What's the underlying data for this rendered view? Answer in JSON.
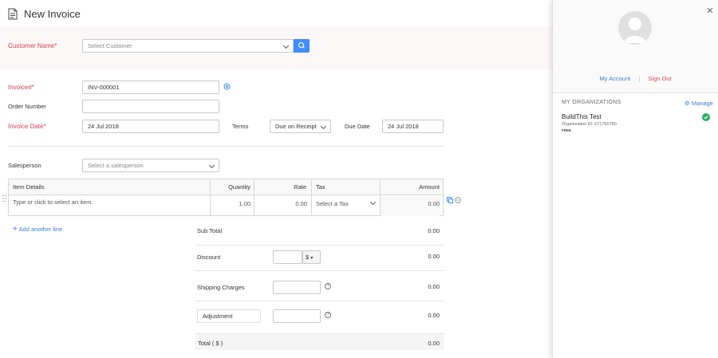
{
  "header": {
    "title": "New Invoice",
    "icon": "document-icon"
  },
  "customer": {
    "label": "Customer Name*",
    "placeholder": "Select Customer"
  },
  "invoice_number": {
    "label": "Invoice#*",
    "value": "INV-000001"
  },
  "order_number": {
    "label": "Order Number",
    "value": ""
  },
  "invoice_date": {
    "label": "Invoice Date*",
    "value": "24 Jul 2018"
  },
  "terms": {
    "label": "Terms",
    "value": "Due on Receipt"
  },
  "due_date": {
    "label": "Due Date",
    "value": "24 Jul 2018"
  },
  "salesperson": {
    "label": "Salesperson",
    "placeholder": "Select a salesperson"
  },
  "items_table": {
    "headers": {
      "item": "Item Details",
      "quantity": "Quantity",
      "rate": "Rate",
      "tax": "Tax",
      "amount": "Amount"
    },
    "row": {
      "item_placeholder": "Type or click to select an item.",
      "quantity": "1.00",
      "rate": "0.00",
      "tax": "Select a Tax",
      "amount": "0.00"
    }
  },
  "add_line": "Add another line",
  "totals": {
    "sub_total_label": "Sub Total",
    "sub_total": "0.00",
    "discount_label": "Discount",
    "discount_unit": "$",
    "discount": "0.00",
    "shipping_label": "Shipping Charges",
    "shipping": "0.00",
    "adjustment_label": "Adjustment",
    "adjustment": "0.00",
    "total_label": "Total ( $ )",
    "total": "0.00"
  },
  "account_panel": {
    "my_account": "My Account",
    "divider": "|",
    "sign_out": "Sign Out",
    "orgs_heading": "MY ORGANIZATIONS",
    "manage": "Manage",
    "org_name": "BuildThis Test",
    "org_id": "Organization ID: 671760780",
    "org_plan": "FREE"
  },
  "colors": {
    "accent": "#408dfb",
    "required": "#d2434f",
    "success": "#27ae60",
    "link": "#3a7bd5"
  }
}
